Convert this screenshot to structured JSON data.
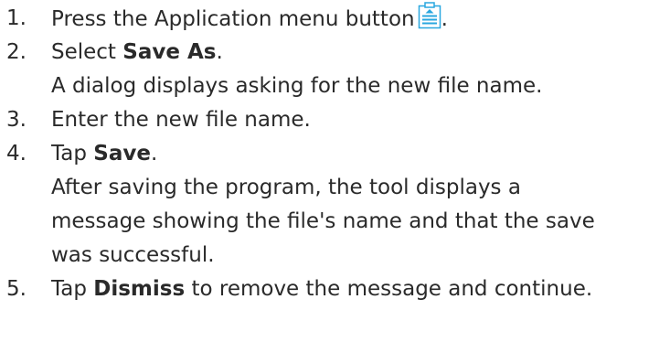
{
  "steps": [
    {
      "number": "1.",
      "text_before": "Press the Application menu button",
      "icon": "application-menu-icon",
      "text_after": "."
    },
    {
      "number": "2.",
      "text_before": "Select ",
      "bold": "Save As",
      "text_after": ".",
      "note": "A dialog displays asking for the new file name."
    },
    {
      "number": "3.",
      "text": "Enter the new file name."
    },
    {
      "number": "4.",
      "text_before": "Tap ",
      "bold": "Save",
      "text_after": ".",
      "note_lines": [
        "After saving the program, the tool displays a",
        "message showing the file's name and that the save",
        "was successful."
      ]
    },
    {
      "number": "5.",
      "text_before": "Tap ",
      "bold": "Dismiss",
      "text_after": " to remove the message and continue."
    }
  ],
  "colors": {
    "text": "#2a2a2a",
    "icon_accent": "#29a7df"
  }
}
